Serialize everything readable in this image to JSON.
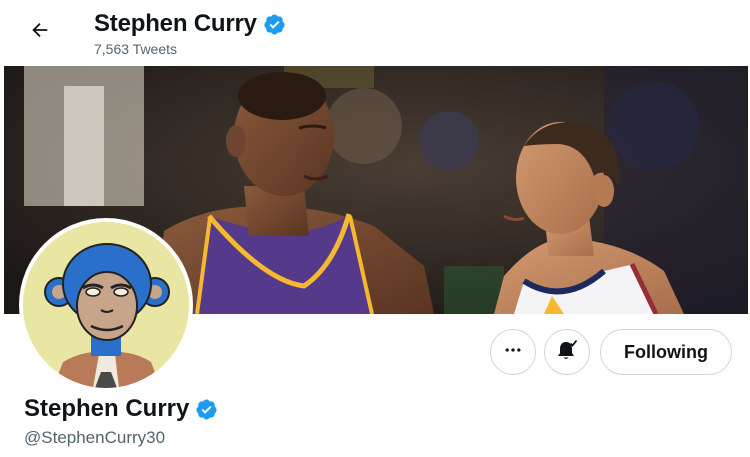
{
  "header": {
    "name": "Stephen Curry",
    "tweet_count": "7,563 Tweets"
  },
  "actions": {
    "more_icon": "more-horizontal-icon",
    "notify_icon": "bell-check-icon",
    "following_label": "Following"
  },
  "profile": {
    "name": "Stephen Curry",
    "handle": "@StephenCurry30"
  },
  "colors": {
    "verified": "#1d9bf0",
    "text_primary": "#0f1419",
    "text_secondary": "#536471",
    "border": "#cfd9de",
    "purple_jersey": "#553a8c",
    "gold_trim": "#f5b82e",
    "avatar_bg": "#e9e6a4",
    "ape_blue": "#2a6fc9"
  }
}
